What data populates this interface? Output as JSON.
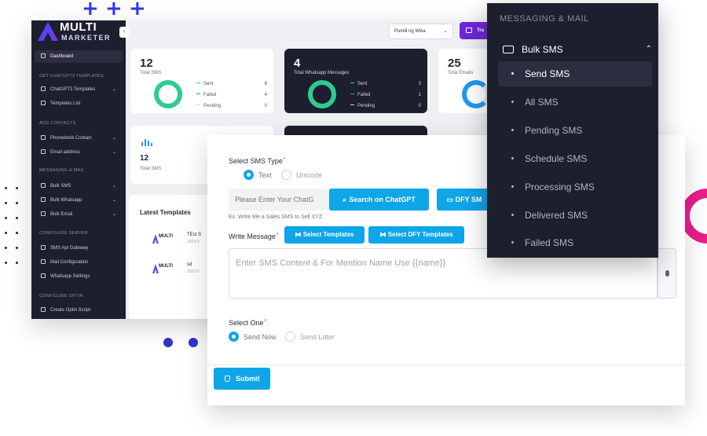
{
  "brand": {
    "line1": "MULTI",
    "line2": "MARKETER"
  },
  "sidebar": {
    "items": [
      {
        "label": "Dashboard"
      },
      {
        "label": "ChatGPT3 Templates"
      },
      {
        "label": "Templates List"
      },
      {
        "label": "Phonebook Contact"
      },
      {
        "label": "Email address"
      },
      {
        "label": "Bulk SMS"
      },
      {
        "label": "Bulk Whatsapp"
      },
      {
        "label": "Bulk Email"
      },
      {
        "label": "SMS Api Gateway"
      },
      {
        "label": "Mail Configuration"
      },
      {
        "label": "Whatsapp Settings"
      },
      {
        "label": "Create Optin Script"
      }
    ],
    "headers": [
      "GET CHATGPT3 TEMPLATES",
      "ADD CONTACTS",
      "MESSAGING & MAIL",
      "CONFIGURE SERVER",
      "CONFIGURE OPTIN"
    ]
  },
  "topbar": {
    "language": "Pumili ng Wika",
    "button_label": "Tra"
  },
  "cards": [
    {
      "number": "12",
      "label": "Total SMS",
      "legend": [
        {
          "label": "Sent",
          "value": "8"
        },
        {
          "label": "Failed",
          "value": "4"
        },
        {
          "label": "Pending",
          "value": "0"
        }
      ]
    },
    {
      "number": "4",
      "label": "Total Whatsapp Messages",
      "legend": [
        {
          "label": "Sent",
          "value": "3"
        },
        {
          "label": "Failed",
          "value": "1"
        },
        {
          "label": "Pending",
          "value": "0"
        }
      ]
    },
    {
      "number": "25",
      "label": "Total Emails"
    },
    {
      "number": "12",
      "label": "Total SMS"
    }
  ],
  "latest_templates": {
    "title": "Latest Templates",
    "rows": [
      {
        "name": "TEst S",
        "date": "2023-0"
      },
      {
        "name": "sd",
        "date": "2023-0"
      }
    ]
  },
  "form": {
    "sms_type_label": "Select SMS Type",
    "sms_type_options": [
      "Text",
      "Unicode"
    ],
    "chatgpt_placeholder": "Please Enter Your ChatG",
    "search_chatgpt": "Search on ChatGPT",
    "dfy_button": "DFY SM",
    "hint": "Ex. Write Me a Sales SMS to Sell XYZ.",
    "write_message_label": "Write Message",
    "select_templates": "Select Templates",
    "select_dfy_templates": "Select DFY Templates",
    "message_placeholder": "Enter SMS Content &  For Mention Name Use  {{name}}",
    "select_one_label": "Select One",
    "send_options": [
      "Send Now",
      "Send Later"
    ],
    "submit": "Submit"
  },
  "menu": {
    "header": "MESSAGING & MAIL",
    "parent": "Bulk SMS",
    "items": [
      "Send SMS",
      "All SMS",
      "Pending SMS",
      "Schedule SMS",
      "Processing SMS",
      "Delivered SMS",
      "Failed SMS"
    ]
  },
  "colors": {
    "accent": "#0ea5e9",
    "sidebar": "#1e1f2e",
    "purple": "#6d28d9",
    "green": "#2ecc8f",
    "pink": "#e91e8c"
  }
}
